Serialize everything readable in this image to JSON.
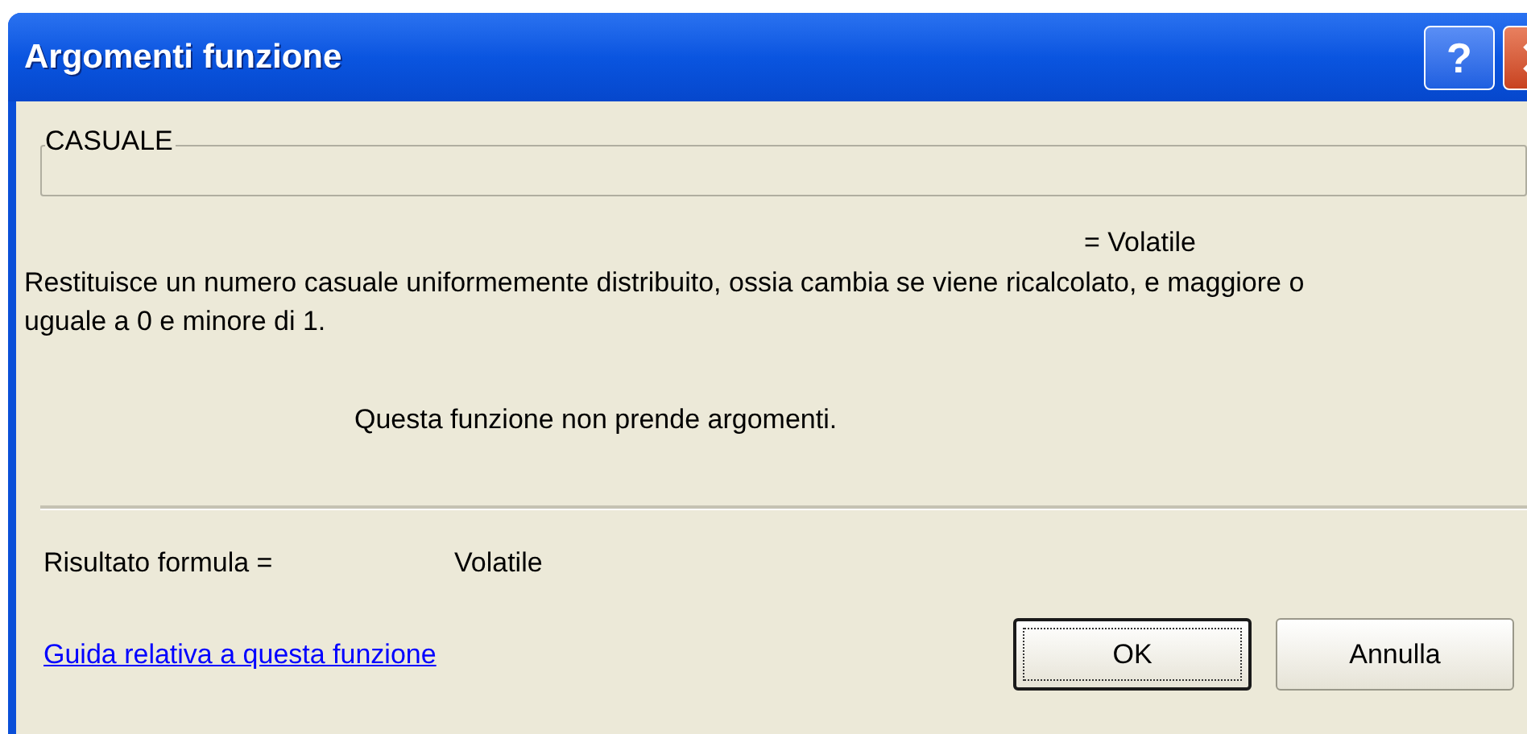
{
  "window": {
    "title": "Argomenti funzione",
    "help_button": "?"
  },
  "function_group": {
    "label": "CASUALE"
  },
  "preview_value": "= Volatile",
  "description": "Restituisce un numero casuale uniformemente distribuito, ossia cambia se viene ricalcolato, e maggiore o uguale a 0 e minore di 1.",
  "no_arguments_note": "Questa funzione non prende argomenti.",
  "result": {
    "label": "Risultato formula =",
    "value": "Volatile"
  },
  "help_link": "Guida relativa a questa funzione",
  "buttons": [
    {
      "label": "OK",
      "default": true
    },
    {
      "label": "Annulla",
      "default": false
    }
  ]
}
